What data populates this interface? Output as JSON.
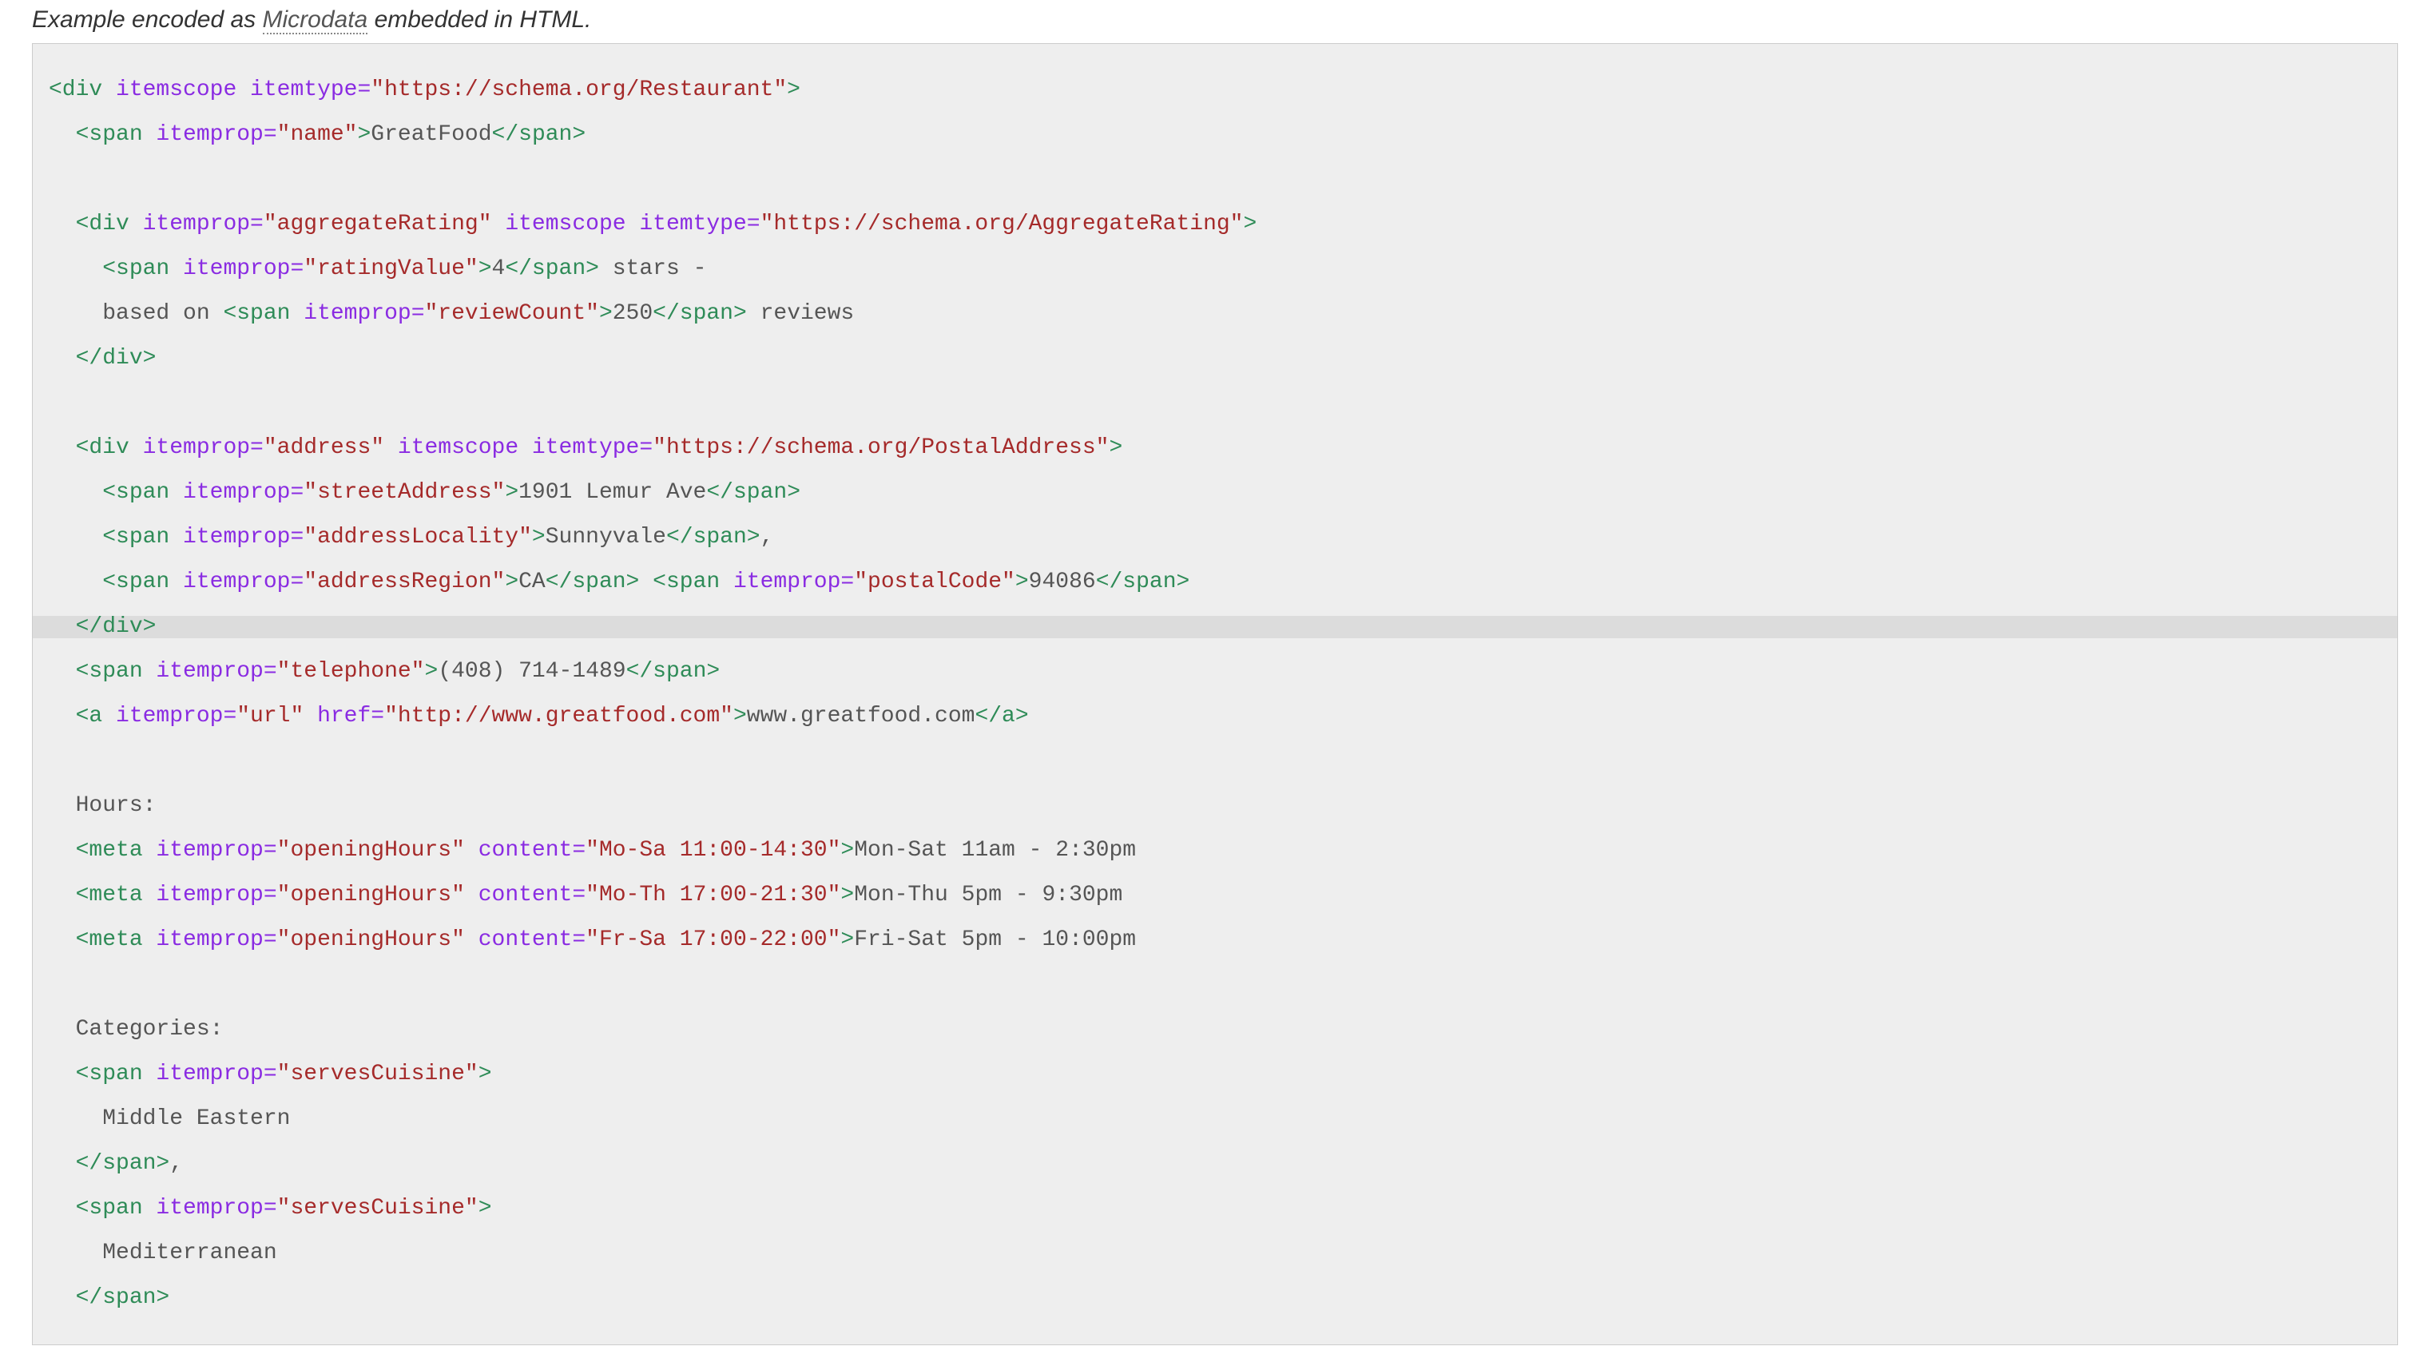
{
  "caption": {
    "prefix": "Example encoded as ",
    "link_text": "Microdata",
    "suffix": " embedded in HTML."
  },
  "code": {
    "l01": {
      "tag_open": "<div",
      "attr1": " itemscope",
      "attr2": " itemtype=",
      "val1": "\"https://schema.org/Restaurant\"",
      "tag_close": ">"
    },
    "l02": {
      "indent": "  ",
      "tag_open": "<span",
      "attr1": " itemprop=",
      "val1": "\"name\"",
      "tag_close": ">",
      "text": "GreatFood",
      "end_tag": "</span>"
    },
    "l03": "",
    "l04": {
      "indent": "  ",
      "tag_open": "<div",
      "attr1": " itemprop=",
      "val1": "\"aggregateRating\"",
      "attr2": " itemscope",
      "attr3": " itemtype=",
      "val2": "\"https://schema.org/AggregateRating\"",
      "tag_close": ">"
    },
    "l05": {
      "indent": "    ",
      "tag_open": "<span",
      "attr1": " itemprop=",
      "val1": "\"ratingValue\"",
      "tag_close": ">",
      "text1": "4",
      "end_tag": "</span>",
      "text2": " stars -"
    },
    "l06": {
      "indent": "    ",
      "text1": "based on ",
      "tag_open": "<span",
      "attr1": " itemprop=",
      "val1": "\"reviewCount\"",
      "tag_close": ">",
      "text2": "250",
      "end_tag": "</span>",
      "text3": " reviews"
    },
    "l07": {
      "indent": "  ",
      "end_tag": "</div>"
    },
    "l08": "",
    "l09": {
      "indent": "  ",
      "tag_open": "<div",
      "attr1": " itemprop=",
      "val1": "\"address\"",
      "attr2": " itemscope",
      "attr3": " itemtype=",
      "val2": "\"https://schema.org/PostalAddress\"",
      "tag_close": ">"
    },
    "l10": {
      "indent": "    ",
      "tag_open": "<span",
      "attr1": " itemprop=",
      "val1": "\"streetAddress\"",
      "tag_close": ">",
      "text": "1901 Lemur Ave",
      "end_tag": "</span>"
    },
    "l11": {
      "indent": "    ",
      "tag_open": "<span",
      "attr1": " itemprop=",
      "val1": "\"addressLocality\"",
      "tag_close": ">",
      "text": "Sunnyvale",
      "end_tag": "</span>",
      "trail": ","
    },
    "l12": {
      "indent": "    ",
      "tag_open1": "<span",
      "attr1": " itemprop=",
      "val1": "\"addressRegion\"",
      "tag_close1": ">",
      "text1": "CA",
      "end_tag1": "</span>",
      "sep": " ",
      "tag_open2": "<span",
      "attr2": " itemprop=",
      "val2": "\"postalCode\"",
      "tag_close2": ">",
      "text2": "94086",
      "end_tag2": "</span>"
    },
    "l13": {
      "indent": "  ",
      "end_tag": "</div>"
    },
    "l14": {
      "indent": "  ",
      "tag_open": "<span",
      "attr1": " itemprop=",
      "val1": "\"telephone\"",
      "tag_close": ">",
      "text": "(408) 714-1489",
      "end_tag": "</span>"
    },
    "l15": {
      "indent": "  ",
      "tag_open": "<a",
      "attr1": " itemprop=",
      "val1": "\"url\"",
      "attr2": " href=",
      "val2": "\"http://www.greatfood.com\"",
      "tag_close": ">",
      "text": "www.greatfood.com",
      "end_tag": "</a>"
    },
    "l16": "",
    "l17": {
      "indent": "  ",
      "text": "Hours:"
    },
    "l18": {
      "indent": "  ",
      "tag_open": "<meta",
      "attr1": " itemprop=",
      "val1": "\"openingHours\"",
      "attr2": " content=",
      "val2": "\"Mo-Sa 11:00-14:30\"",
      "tag_close": ">",
      "text": "Mon-Sat 11am - 2:30pm"
    },
    "l19": {
      "indent": "  ",
      "tag_open": "<meta",
      "attr1": " itemprop=",
      "val1": "\"openingHours\"",
      "attr2": " content=",
      "val2": "\"Mo-Th 17:00-21:30\"",
      "tag_close": ">",
      "text": "Mon-Thu 5pm - 9:30pm"
    },
    "l20": {
      "indent": "  ",
      "tag_open": "<meta",
      "attr1": " itemprop=",
      "val1": "\"openingHours\"",
      "attr2": " content=",
      "val2": "\"Fr-Sa 17:00-22:00\"",
      "tag_close": ">",
      "text": "Fri-Sat 5pm - 10:00pm"
    },
    "l21": "",
    "l22": {
      "indent": "  ",
      "text": "Categories:"
    },
    "l23": {
      "indent": "  ",
      "tag_open": "<span",
      "attr1": " itemprop=",
      "val1": "\"servesCuisine\"",
      "tag_close": ">"
    },
    "l24": {
      "indent": "    ",
      "text": "Middle Eastern"
    },
    "l25": {
      "indent": "  ",
      "end_tag": "</span>",
      "trail": ","
    },
    "l26": {
      "indent": "  ",
      "tag_open": "<span",
      "attr1": " itemprop=",
      "val1": "\"servesCuisine\"",
      "tag_close": ">"
    },
    "l27": {
      "indent": "    ",
      "text": "Mediterranean"
    },
    "l28": {
      "indent": "  ",
      "end_tag": "</span>"
    }
  }
}
